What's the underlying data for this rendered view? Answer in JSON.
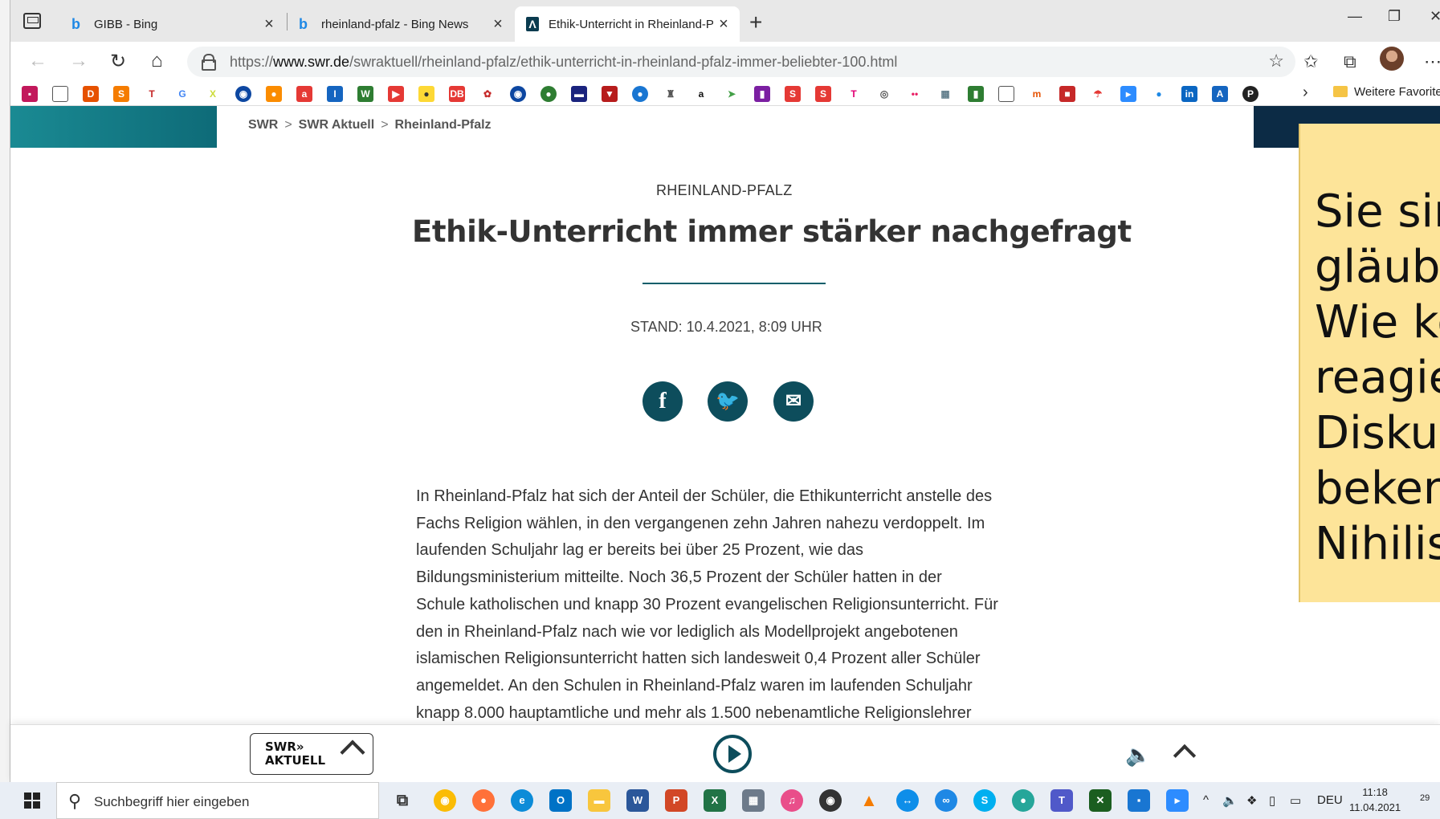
{
  "browser": {
    "tabs": [
      {
        "title": "GIBB - Bing",
        "active": false
      },
      {
        "title": "rheinland-pfalz - Bing News",
        "active": false
      },
      {
        "title": "Ethik-Unterricht in Rheinland-Pfa",
        "active": true
      }
    ],
    "url_prefix": "https://",
    "url_domain": "www.swr.de",
    "url_path": "/swraktuell/rheinland-pfalz/ethik-unterricht-in-rheinland-pfalz-immer-beliebter-100.html",
    "favorites_folder": "Weitere Favoriten"
  },
  "page": {
    "breadcrumb": [
      "SWR",
      "SWR Aktuell",
      "Rheinland-Pfalz"
    ],
    "section": "RHEINLAND-PFALZ",
    "headline": "Ethik-Unterricht immer stärker nachgefragt",
    "stand": "STAND: 10.4.2021, 8:09 UHR",
    "article_lines": [
      "In Rheinland-Pfalz hat sich der Anteil der Schüler, die Ethikunterricht anstelle des",
      "Fachs Religion wählen, in den vergangenen zehn Jahren nahezu verdoppelt. Im",
      "laufenden Schuljahr lag er bereits bei über 25 Prozent, wie das",
      "Bildungsministerium mitteilte. Noch 36,5 Prozent der Schüler hatten in der",
      "Schule katholischen und knapp 30 Prozent evangelischen Religionsunterricht. Für",
      "den in Rheinland-Pfalz nach wie vor lediglich als Modellprojekt angebotenen",
      "islamischen Religionsunterricht hatten sich landesweit 0,4 Prozent aller Schüler",
      "angemeldet. An den Schulen in Rheinland-Pfalz waren im laufenden Schuljahr",
      "knapp 8.000 hauptamtliche und mehr als 1.500 nebenamtliche Religionslehrer"
    ]
  },
  "note_lines": [
    "Sie sin",
    "gläubi",
    "Wie kö",
    "reagie",
    "Diskus",
    "beken",
    "Nihilis"
  ],
  "player": {
    "logo_line1": "SWR»",
    "logo_line2": "AKTUELL"
  },
  "taskbar": {
    "search_placeholder": "Suchbegriff hier eingeben",
    "language": "DEU",
    "time": "11:18",
    "date": "11.04.2021",
    "notification_count": "29"
  }
}
